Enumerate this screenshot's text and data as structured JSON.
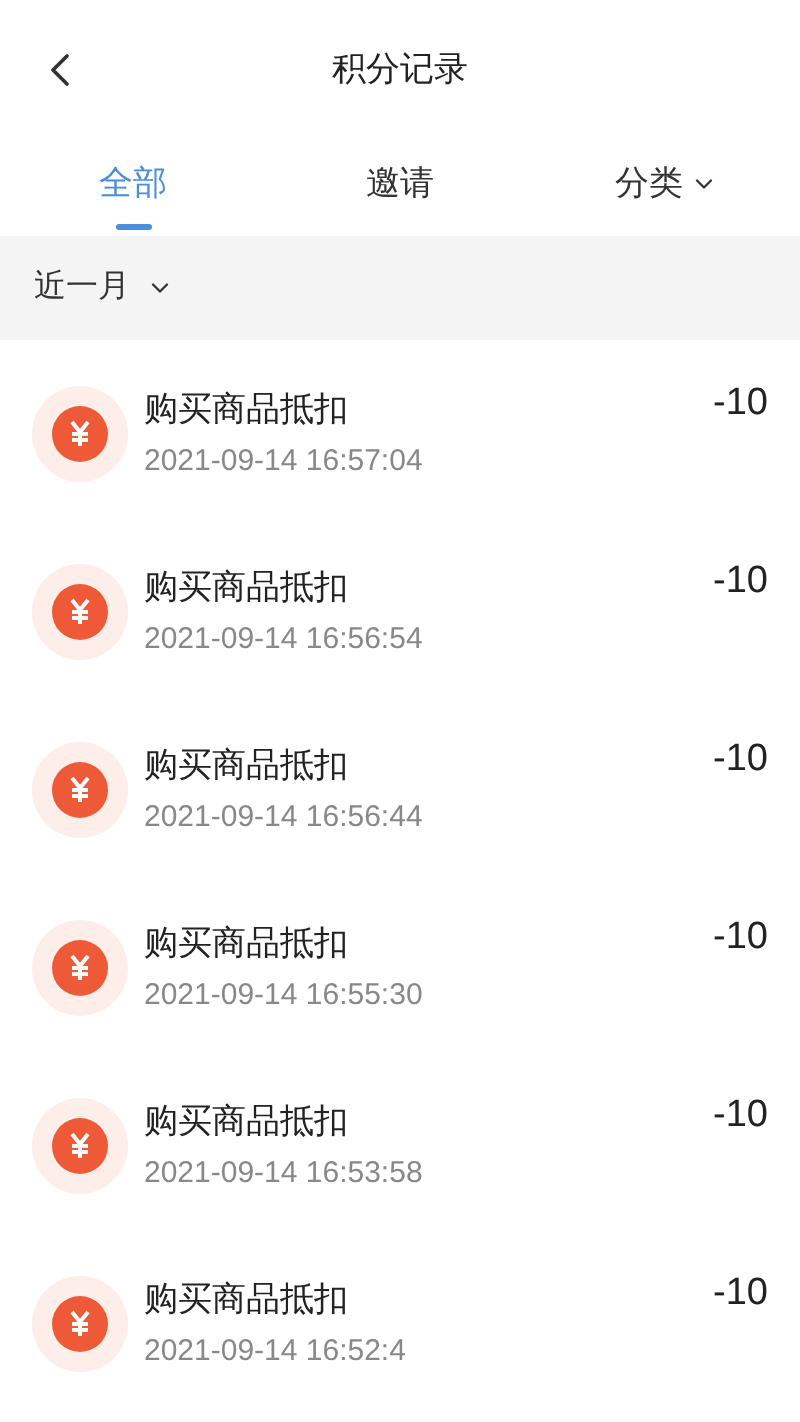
{
  "header": {
    "title": "积分记录"
  },
  "tabs": [
    {
      "label": "全部",
      "selected": true,
      "dropdown": false
    },
    {
      "label": "邀请",
      "selected": false,
      "dropdown": false
    },
    {
      "label": "分类",
      "selected": false,
      "dropdown": true
    }
  ],
  "filter": {
    "label": "近一月"
  },
  "records": [
    {
      "title": "购买商品抵扣",
      "time": "2021-09-14 16:57:04",
      "amount": "-10"
    },
    {
      "title": "购买商品抵扣",
      "time": "2021-09-14 16:56:54",
      "amount": "-10"
    },
    {
      "title": "购买商品抵扣",
      "time": "2021-09-14 16:56:44",
      "amount": "-10"
    },
    {
      "title": "购买商品抵扣",
      "time": "2021-09-14 16:55:30",
      "amount": "-10"
    },
    {
      "title": "购买商品抵扣",
      "time": "2021-09-14 16:53:58",
      "amount": "-10"
    },
    {
      "title": "购买商品抵扣",
      "time": "2021-09-14 16:52:4",
      "amount": "-10"
    }
  ]
}
